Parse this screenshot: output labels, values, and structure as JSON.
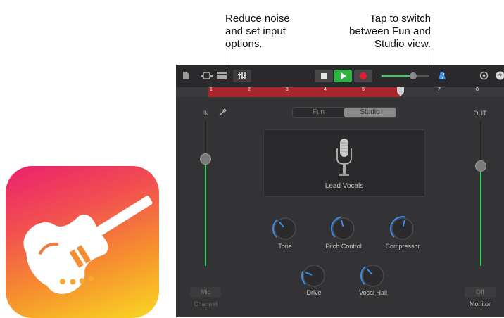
{
  "callouts": {
    "input_options": "Reduce noise\nand set input\noptions.",
    "view_switch": "Tap to switch\nbetween Fun and\nStudio view."
  },
  "ruler": {
    "marks": [
      "1",
      "2",
      "3",
      "4",
      "5",
      "6",
      "7",
      "8"
    ]
  },
  "view_toggle": {
    "fun_label": "Fun",
    "studio_label": "Studio",
    "selected": "Studio"
  },
  "input": {
    "label": "IN",
    "level": 0.72,
    "channel_button": "Mic",
    "channel_label": "Channel"
  },
  "output": {
    "label": "OUT",
    "level": 0.7,
    "monitor_button": "Off",
    "monitor_label": "Monitor"
  },
  "preset": {
    "name": "Lead Vocals"
  },
  "knobs": [
    {
      "label": "Tone",
      "value": 0.35
    },
    {
      "label": "Pitch Control",
      "value": 0.45
    },
    {
      "label": "Compressor",
      "value": 0.55
    },
    {
      "label": "Drive",
      "value": 0.25
    },
    {
      "label": "Vocal Hall",
      "value": 0.35
    }
  ],
  "colors": {
    "accent_blue": "#3b8de6",
    "level_green": "#33d05c",
    "record_red": "#e0212b",
    "play_green": "#2fb344",
    "ruler_red": "#a9262c"
  },
  "icons": [
    "document-icon",
    "loop-icon",
    "tracks-icon",
    "mixer-icon",
    "stop-icon",
    "play-icon",
    "record-icon",
    "metronome-icon",
    "settings-icon",
    "help-icon",
    "microphone-icon",
    "input-settings-icon",
    "garageband-guitar-icon"
  ]
}
